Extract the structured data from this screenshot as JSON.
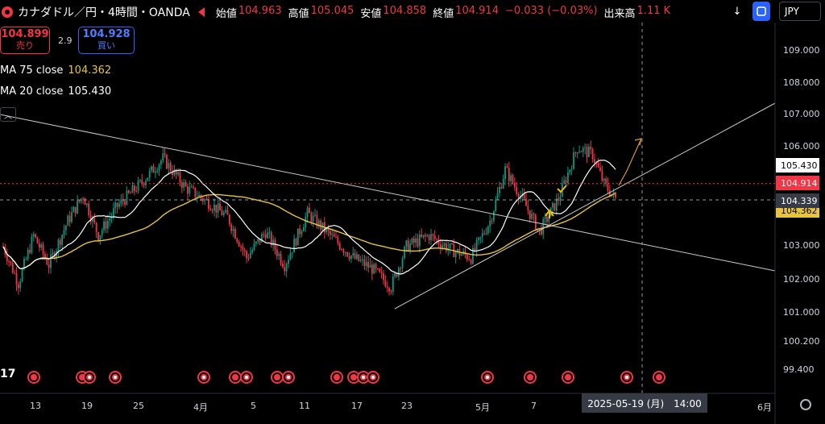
{
  "header": {
    "title": "カナダドル／円・4時間・OANDA",
    "ohlc": [
      {
        "label": "始値",
        "value": "104.963"
      },
      {
        "label": "高値",
        "value": "105.045"
      },
      {
        "label": "安値",
        "value": "104.858"
      },
      {
        "label": "終値",
        "value": "104.914"
      }
    ],
    "change": "−0.033 (−0.03%)",
    "volume_label": "出来高",
    "volume_value": "1.11 K",
    "currency": "JPY",
    "colors": {
      "down": "#f23645",
      "up": "#089981",
      "accent": "#2962ff"
    }
  },
  "trade": {
    "sell_price": "104.899",
    "sell_label": "売り",
    "spread": "2.9",
    "buy_price": "104.928",
    "buy_label": "買い"
  },
  "indicators": [
    {
      "name": "MA 75 close",
      "value": "104.362",
      "color": "#e8c43a"
    },
    {
      "name": "MA 20 close",
      "value": "105.430",
      "color": "#ffffff"
    }
  ],
  "y_axis": {
    "ticks": [
      "109.000",
      "108.000",
      "107.000",
      "106.000",
      "103.000",
      "102.000",
      "101.000",
      "100.200",
      "99.400"
    ],
    "tags": [
      {
        "text": "105.430",
        "kind": "ma20"
      },
      {
        "text": "104.914",
        "kind": "last"
      },
      {
        "text": "104.339",
        "kind": "cursor"
      },
      {
        "text": "104.362",
        "kind": "ma75"
      }
    ]
  },
  "x_axis": {
    "ticks": [
      "13",
      "19",
      "25",
      "4月",
      "5",
      "11",
      "17",
      "23",
      "5月",
      "7",
      "6月"
    ],
    "cursor_label": "2025-05-19 (月)　14:00"
  },
  "chart_data": {
    "type": "candlestick",
    "symbol": "CADJPY",
    "timeframe": "4時間",
    "ylim": [
      99.2,
      109.3
    ],
    "series": [
      {
        "name": "MA 75 close",
        "kind": "line",
        "last": 104.362
      },
      {
        "name": "MA 20 close",
        "kind": "line",
        "last": 105.43
      }
    ],
    "last_close": 104.914
  },
  "icons": [
    "tradingview-logo",
    "arrow-down-icon",
    "maximize-icon",
    "settings-icon"
  ]
}
